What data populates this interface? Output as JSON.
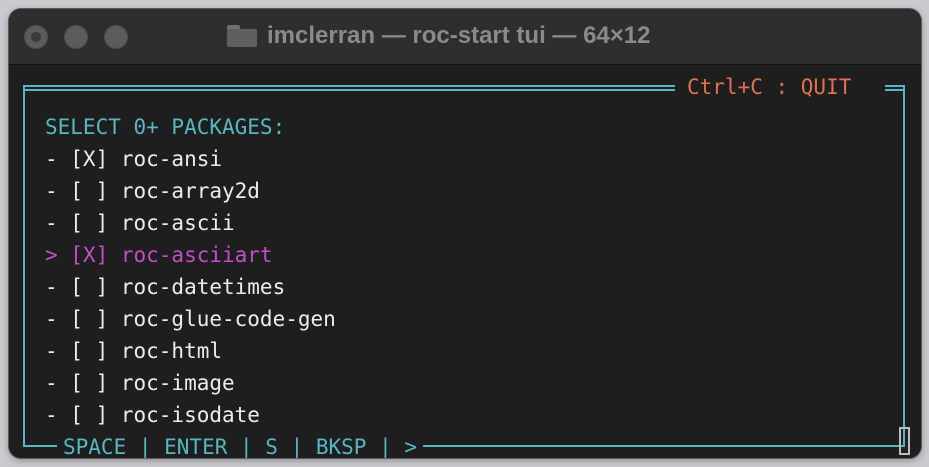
{
  "window": {
    "title": "imclerran — roc-start tui — 64×12"
  },
  "terminal": {
    "quit_hint": "Ctrl+C : QUIT",
    "header": "SELECT 0+ PACKAGES:",
    "packages": [
      "- [X] roc-ansi",
      "- [ ] roc-array2d",
      "- [ ] roc-ascii",
      "> [X] roc-asciiart",
      "- [ ] roc-datetimes",
      "- [ ] roc-glue-code-gen",
      "- [ ] roc-html",
      "- [ ] roc-image",
      "- [ ] roc-isodate"
    ],
    "footer": "SPACE | ENTER | S | BKSP | >"
  },
  "colors": {
    "border": "#56b6c2",
    "quit": "#e0704f",
    "highlight": "#c34ec9",
    "text": "#ececec"
  },
  "icons": [
    "folder-icon"
  ]
}
